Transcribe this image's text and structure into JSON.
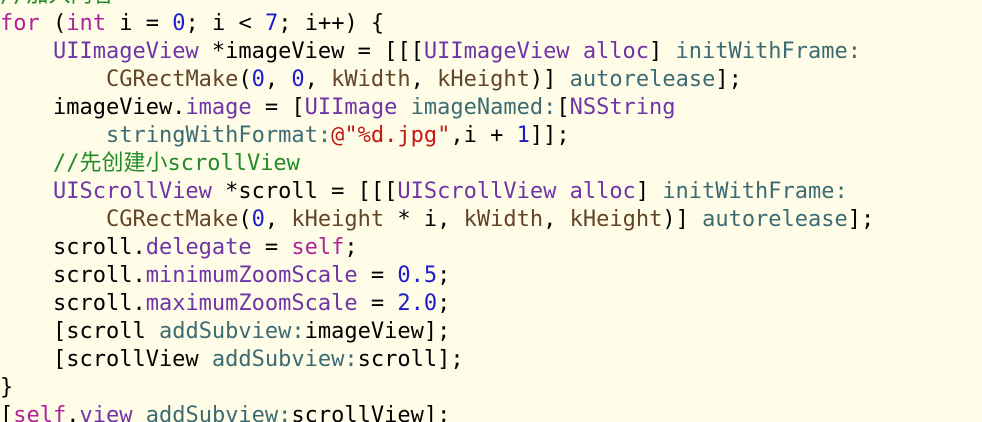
{
  "colors": {
    "background": "#fffde8",
    "plain": "#000000",
    "keyword": "#b0239a",
    "type": "#6f35a6",
    "method": "#3d6b74",
    "macro": "#644427",
    "number": "#1f1ccf",
    "string": "#c31a16",
    "comment": "#238b2a"
  },
  "clipped_top_text": "//加入内容",
  "code_lines": [
    [
      {
        "t": "for",
        "c": "keyword"
      },
      {
        "t": " (",
        "c": "plain"
      },
      {
        "t": "int",
        "c": "keyword"
      },
      {
        "t": " i = ",
        "c": "plain"
      },
      {
        "t": "0",
        "c": "number"
      },
      {
        "t": "; i < ",
        "c": "plain"
      },
      {
        "t": "7",
        "c": "number"
      },
      {
        "t": "; i++) {",
        "c": "plain"
      }
    ],
    [
      {
        "t": "    ",
        "c": "plain"
      },
      {
        "t": "UIImageView",
        "c": "type"
      },
      {
        "t": " *imageView = [[[",
        "c": "plain"
      },
      {
        "t": "UIImageView",
        "c": "type"
      },
      {
        "t": " ",
        "c": "plain"
      },
      {
        "t": "alloc",
        "c": "type"
      },
      {
        "t": "] ",
        "c": "plain"
      },
      {
        "t": "initWithFrame:",
        "c": "method"
      }
    ],
    [
      {
        "t": "        ",
        "c": "plain"
      },
      {
        "t": "CGRectMake",
        "c": "macro"
      },
      {
        "t": "(",
        "c": "plain"
      },
      {
        "t": "0",
        "c": "number"
      },
      {
        "t": ", ",
        "c": "plain"
      },
      {
        "t": "0",
        "c": "number"
      },
      {
        "t": ", ",
        "c": "plain"
      },
      {
        "t": "kWidth",
        "c": "macro"
      },
      {
        "t": ", ",
        "c": "plain"
      },
      {
        "t": "kHeight",
        "c": "macro"
      },
      {
        "t": ")] ",
        "c": "plain"
      },
      {
        "t": "autorelease",
        "c": "method"
      },
      {
        "t": "];",
        "c": "plain"
      }
    ],
    [
      {
        "t": "    imageView.",
        "c": "plain"
      },
      {
        "t": "image",
        "c": "type"
      },
      {
        "t": " = [",
        "c": "plain"
      },
      {
        "t": "UIImage",
        "c": "type"
      },
      {
        "t": " ",
        "c": "plain"
      },
      {
        "t": "imageNamed:",
        "c": "method"
      },
      {
        "t": "[",
        "c": "plain"
      },
      {
        "t": "NSString",
        "c": "type"
      }
    ],
    [
      {
        "t": "        ",
        "c": "plain"
      },
      {
        "t": "stringWithFormat:",
        "c": "method"
      },
      {
        "t": "@\"%d.jpg\"",
        "c": "string"
      },
      {
        "t": ",i + ",
        "c": "plain"
      },
      {
        "t": "1",
        "c": "number"
      },
      {
        "t": "]];",
        "c": "plain"
      }
    ],
    [
      {
        "t": "    ",
        "c": "plain"
      },
      {
        "t": "//先创建小scrollView",
        "c": "comment"
      }
    ],
    [
      {
        "t": "    ",
        "c": "plain"
      },
      {
        "t": "UIScrollView",
        "c": "type"
      },
      {
        "t": " *scroll = [[[",
        "c": "plain"
      },
      {
        "t": "UIScrollView",
        "c": "type"
      },
      {
        "t": " ",
        "c": "plain"
      },
      {
        "t": "alloc",
        "c": "type"
      },
      {
        "t": "] ",
        "c": "plain"
      },
      {
        "t": "initWithFrame:",
        "c": "method"
      }
    ],
    [
      {
        "t": "        ",
        "c": "plain"
      },
      {
        "t": "CGRectMake",
        "c": "macro"
      },
      {
        "t": "(",
        "c": "plain"
      },
      {
        "t": "0",
        "c": "number"
      },
      {
        "t": ", ",
        "c": "plain"
      },
      {
        "t": "kHeight",
        "c": "macro"
      },
      {
        "t": " * i, ",
        "c": "plain"
      },
      {
        "t": "kWidth",
        "c": "macro"
      },
      {
        "t": ", ",
        "c": "plain"
      },
      {
        "t": "kHeight",
        "c": "macro"
      },
      {
        "t": ")] ",
        "c": "plain"
      },
      {
        "t": "autorelease",
        "c": "method"
      },
      {
        "t": "];",
        "c": "plain"
      }
    ],
    [
      {
        "t": "    scroll.",
        "c": "plain"
      },
      {
        "t": "delegate",
        "c": "type"
      },
      {
        "t": " = ",
        "c": "plain"
      },
      {
        "t": "self",
        "c": "keyword"
      },
      {
        "t": ";",
        "c": "plain"
      }
    ],
    [
      {
        "t": "    scroll.",
        "c": "plain"
      },
      {
        "t": "minimumZoomScale",
        "c": "type"
      },
      {
        "t": " = ",
        "c": "plain"
      },
      {
        "t": "0.5",
        "c": "number"
      },
      {
        "t": ";",
        "c": "plain"
      }
    ],
    [
      {
        "t": "    scroll.",
        "c": "plain"
      },
      {
        "t": "maximumZoomScale",
        "c": "type"
      },
      {
        "t": " = ",
        "c": "plain"
      },
      {
        "t": "2.0",
        "c": "number"
      },
      {
        "t": ";",
        "c": "plain"
      }
    ],
    [
      {
        "t": "    [scroll ",
        "c": "plain"
      },
      {
        "t": "addSubview:",
        "c": "method"
      },
      {
        "t": "imageView];",
        "c": "plain"
      }
    ],
    [
      {
        "t": "    [scrollView ",
        "c": "plain"
      },
      {
        "t": "addSubview:",
        "c": "method"
      },
      {
        "t": "scroll];",
        "c": "plain"
      }
    ],
    [
      {
        "t": "}",
        "c": "plain"
      }
    ],
    [
      {
        "t": "[",
        "c": "plain"
      },
      {
        "t": "self",
        "c": "keyword"
      },
      {
        "t": ".",
        "c": "plain"
      },
      {
        "t": "view",
        "c": "type"
      },
      {
        "t": " ",
        "c": "plain"
      },
      {
        "t": "addSubview:",
        "c": "method"
      },
      {
        "t": "scrollView];",
        "c": "plain"
      }
    ]
  ]
}
